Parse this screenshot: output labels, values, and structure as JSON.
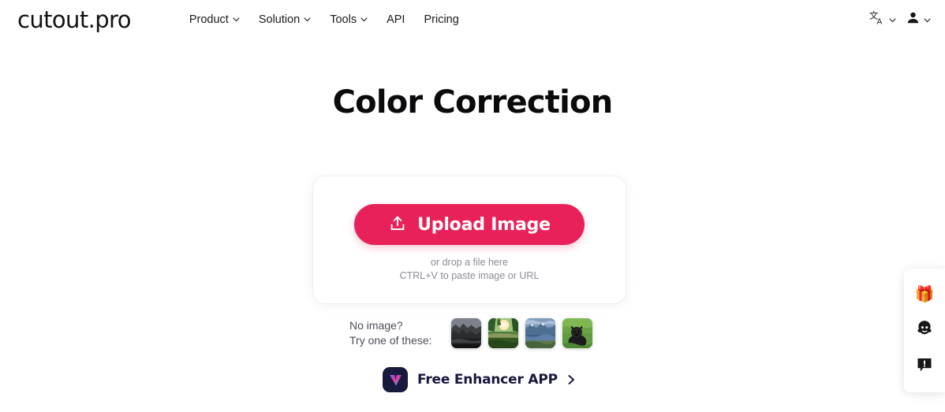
{
  "brand": {
    "logo_text": "cutout.pro"
  },
  "header": {
    "nav": [
      {
        "label": "Product",
        "has_caret": true,
        "icon": "chevron-down-icon"
      },
      {
        "label": "Solution",
        "has_caret": true,
        "icon": "chevron-down-icon"
      },
      {
        "label": "Tools",
        "has_caret": true,
        "icon": "chevron-down-icon"
      },
      {
        "label": "API",
        "has_caret": false,
        "icon": ""
      },
      {
        "label": "Pricing",
        "has_caret": false,
        "icon": ""
      }
    ],
    "language_icon": "translate-icon",
    "account_icon": "user-icon"
  },
  "main": {
    "title": "Color Correction",
    "upload": {
      "button_label": "Upload Image",
      "button_icon": "upload-icon",
      "button_color": "#E8215A",
      "drop_line1": "or drop a file here",
      "drop_line2": "CTRL+V to paste image or URL"
    },
    "samples": {
      "line1": "No image?",
      "line2": "Try one of these:",
      "thumbnails": [
        {
          "name": "sample-rocky-shore",
          "alt": "dark rocky coastline"
        },
        {
          "name": "sample-sunset-trees",
          "alt": "sunset over trees and river"
        },
        {
          "name": "sample-mountain-lake",
          "alt": "mountain and lake landscape"
        },
        {
          "name": "sample-black-puppy",
          "alt": "black puppy on grass"
        }
      ]
    },
    "app_promo": {
      "icon": "vance-app-icon",
      "label": "Free Enhancer APP",
      "arrow": "chevron-right-icon"
    }
  },
  "side_widget": {
    "items": [
      {
        "name": "gift-icon",
        "glyph": "🎁",
        "label": "Gift"
      },
      {
        "name": "support-face-icon",
        "glyph": "",
        "label": "Support"
      },
      {
        "name": "feedback-icon",
        "glyph": "",
        "label": "Feedback"
      }
    ]
  }
}
